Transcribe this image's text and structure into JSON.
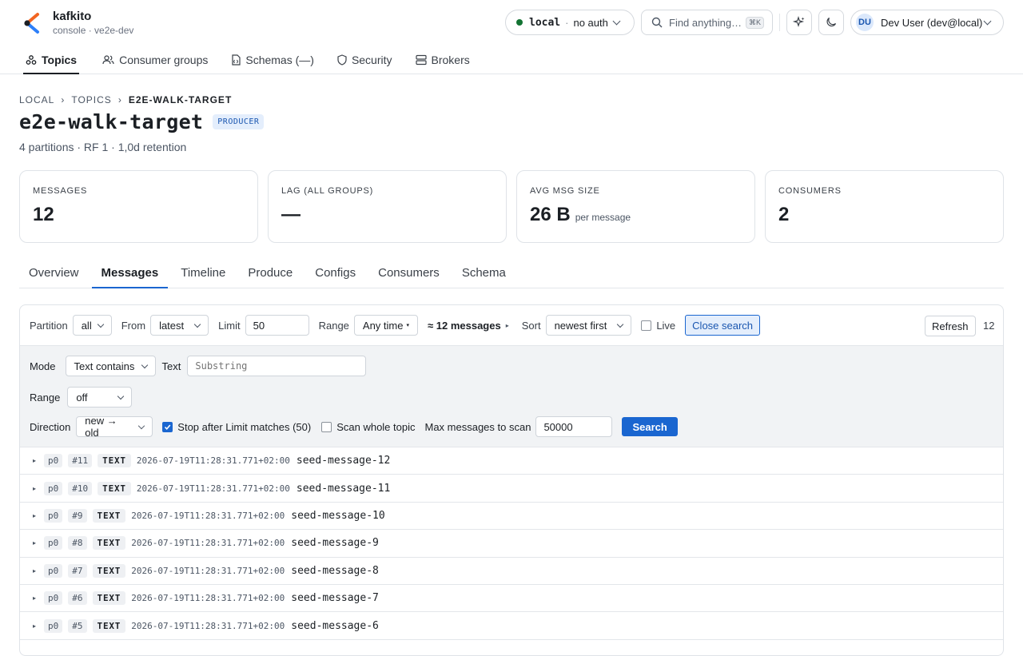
{
  "brand": {
    "name": "kafkito",
    "sub": "console · ve2e-dev"
  },
  "env": {
    "name": "local",
    "sep": "·",
    "auth": "no auth"
  },
  "search": {
    "placeholder": "Find anything…",
    "shortcut": "⌘K"
  },
  "user": {
    "initials": "DU",
    "name": "Dev User (dev@local)"
  },
  "nav": [
    {
      "label": "Topics",
      "icon": "topics-icon"
    },
    {
      "label": "Consumer groups",
      "icon": "users-icon"
    },
    {
      "label": "Schemas (—)",
      "icon": "file-icon"
    },
    {
      "label": "Security",
      "icon": "shield-icon"
    },
    {
      "label": "Brokers",
      "icon": "server-icon"
    }
  ],
  "breadcrumb": [
    "LOCAL",
    "TOPICS",
    "E2E-WALK-TARGET"
  ],
  "page": {
    "title": "e2e-walk-target",
    "badge": "PRODUCER",
    "subtitle": "4 partitions · RF 1 · 1,0d retention"
  },
  "stats": [
    {
      "label": "MESSAGES",
      "value": "12",
      "unit": ""
    },
    {
      "label": "LAG (ALL GROUPS)",
      "value": "—",
      "unit": ""
    },
    {
      "label": "AVG MSG SIZE",
      "value": "26 B",
      "unit": "per message"
    },
    {
      "label": "CONSUMERS",
      "value": "2",
      "unit": ""
    }
  ],
  "tabs": [
    "Overview",
    "Messages",
    "Timeline",
    "Produce",
    "Configs",
    "Consumers",
    "Schema"
  ],
  "toolbar": {
    "partition_label": "Partition",
    "partition_value": "all",
    "from_label": "From",
    "from_value": "latest",
    "limit_label": "Limit",
    "limit_value": "50",
    "range_label": "Range",
    "range_value": "Any time",
    "approx": "≈ 12 messages",
    "sort_label": "Sort",
    "sort_value": "newest first",
    "live_label": "Live",
    "close_search": "Close search",
    "refresh": "Refresh",
    "count": "12"
  },
  "search_form": {
    "mode_label": "Mode",
    "mode_value": "Text contains",
    "text_label": "Text",
    "text_placeholder": "Substring",
    "range_label": "Range",
    "range_value": "off",
    "direction_label": "Direction",
    "direction_value": "new → old",
    "stop_after_label": "Stop after Limit matches (50)",
    "scan_whole_label": "Scan whole topic",
    "max_scan_label": "Max messages to scan",
    "max_scan_value": "50000",
    "search_button": "Search"
  },
  "messages": [
    {
      "partition": "p0",
      "offset": "#11",
      "type": "TEXT",
      "timestamp": "2026-07-19T11:28:31.771+02:00",
      "payload": "seed-message-12"
    },
    {
      "partition": "p0",
      "offset": "#10",
      "type": "TEXT",
      "timestamp": "2026-07-19T11:28:31.771+02:00",
      "payload": "seed-message-11"
    },
    {
      "partition": "p0",
      "offset": "#9",
      "type": "TEXT",
      "timestamp": "2026-07-19T11:28:31.771+02:00",
      "payload": "seed-message-10"
    },
    {
      "partition": "p0",
      "offset": "#8",
      "type": "TEXT",
      "timestamp": "2026-07-19T11:28:31.771+02:00",
      "payload": "seed-message-9"
    },
    {
      "partition": "p0",
      "offset": "#7",
      "type": "TEXT",
      "timestamp": "2026-07-19T11:28:31.771+02:00",
      "payload": "seed-message-8"
    },
    {
      "partition": "p0",
      "offset": "#6",
      "type": "TEXT",
      "timestamp": "2026-07-19T11:28:31.771+02:00",
      "payload": "seed-message-7"
    },
    {
      "partition": "p0",
      "offset": "#5",
      "type": "TEXT",
      "timestamp": "2026-07-19T11:28:31.771+02:00",
      "payload": "seed-message-6"
    }
  ],
  "colors": {
    "accent": "#1a66d0",
    "status_ok": "#137333"
  }
}
